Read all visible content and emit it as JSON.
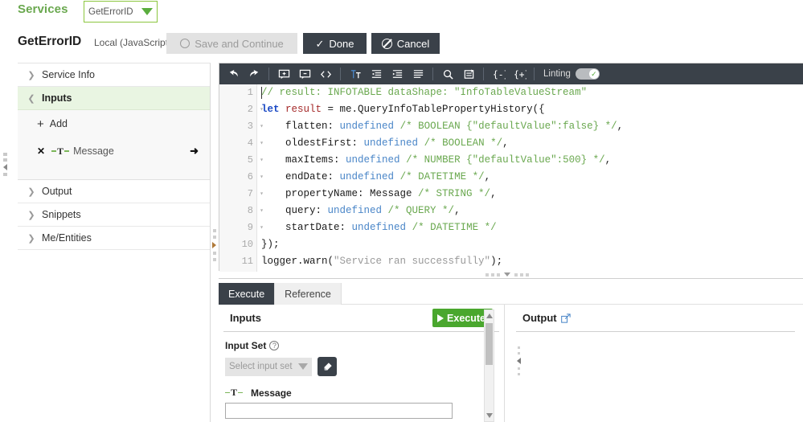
{
  "topbar": {
    "services_label": "Services",
    "entity_name": "GetErrorID",
    "dropdown_icon": "chevron-down-icon"
  },
  "header": {
    "service_name": "GetErrorID",
    "service_subtitle": "Local (JavaScript)",
    "buttons": {
      "save_and_continue": "Save and Continue",
      "done": "Done",
      "cancel": "Cancel"
    }
  },
  "sidebar": {
    "sections": [
      {
        "label": "Service Info",
        "expanded": false
      },
      {
        "label": "Inputs",
        "expanded": true
      },
      {
        "label": "Output",
        "expanded": false
      },
      {
        "label": "Snippets",
        "expanded": false
      },
      {
        "label": "Me/Entities",
        "expanded": false
      }
    ],
    "inputs": {
      "add_label": "Add",
      "items": [
        {
          "name": "Message",
          "type_icon": "string-type-icon",
          "remove_icon": "close-icon",
          "go_icon": "arrow-right-icon"
        }
      ]
    }
  },
  "editor": {
    "toolbar": {
      "icons": [
        "undo-icon",
        "redo-icon",
        "add-comment-icon",
        "remove-comment-icon",
        "code-snippet-icon",
        "font-size-icon",
        "indent-decrease-icon",
        "indent-increase-icon",
        "format-lines-icon",
        "search-icon",
        "find-replace-icon",
        "collapse-braces-icon",
        "expand-braces-icon"
      ],
      "linting_label": "Linting",
      "linting_enabled": true
    },
    "lines": [
      {
        "n": "1",
        "fold": false,
        "tokens": [
          {
            "t": "// result: INFOTABLE dataShape: \"InfoTableValueStream\"",
            "c": "com"
          }
        ]
      },
      {
        "n": "2",
        "fold": true,
        "tokens": [
          {
            "t": "let ",
            "c": "kw"
          },
          {
            "t": "result",
            "c": "var"
          },
          {
            "t": " = me.QueryInfoTablePropertyHistory({",
            "c": "plain"
          }
        ]
      },
      {
        "n": "3",
        "fold": true,
        "tokens": [
          {
            "t": "    flatten: ",
            "c": "plain"
          },
          {
            "t": "undefined",
            "c": "und"
          },
          {
            "t": " ",
            "c": "plain"
          },
          {
            "t": "/* BOOLEAN {\"defaultValue\":false} */",
            "c": "com"
          },
          {
            "t": ",",
            "c": "plain"
          }
        ]
      },
      {
        "n": "4",
        "fold": true,
        "tokens": [
          {
            "t": "    oldestFirst: ",
            "c": "plain"
          },
          {
            "t": "undefined",
            "c": "und"
          },
          {
            "t": " ",
            "c": "plain"
          },
          {
            "t": "/* BOOLEAN */",
            "c": "com"
          },
          {
            "t": ",",
            "c": "plain"
          }
        ]
      },
      {
        "n": "5",
        "fold": true,
        "tokens": [
          {
            "t": "    maxItems: ",
            "c": "plain"
          },
          {
            "t": "undefined",
            "c": "und"
          },
          {
            "t": " ",
            "c": "plain"
          },
          {
            "t": "/* NUMBER {\"defaultValue\":500} */",
            "c": "com"
          },
          {
            "t": ",",
            "c": "plain"
          }
        ]
      },
      {
        "n": "6",
        "fold": true,
        "tokens": [
          {
            "t": "    endDate: ",
            "c": "plain"
          },
          {
            "t": "undefined",
            "c": "und"
          },
          {
            "t": " ",
            "c": "plain"
          },
          {
            "t": "/* DATETIME */",
            "c": "com"
          },
          {
            "t": ",",
            "c": "plain"
          }
        ]
      },
      {
        "n": "7",
        "fold": true,
        "tokens": [
          {
            "t": "    propertyName: Message ",
            "c": "plain"
          },
          {
            "t": "/* STRING */",
            "c": "com"
          },
          {
            "t": ",",
            "c": "plain"
          }
        ]
      },
      {
        "n": "8",
        "fold": true,
        "tokens": [
          {
            "t": "    query: ",
            "c": "plain"
          },
          {
            "t": "undefined",
            "c": "und"
          },
          {
            "t": " ",
            "c": "plain"
          },
          {
            "t": "/* QUERY */",
            "c": "com"
          },
          {
            "t": ",",
            "c": "plain"
          }
        ]
      },
      {
        "n": "9",
        "fold": true,
        "tokens": [
          {
            "t": "    startDate: ",
            "c": "plain"
          },
          {
            "t": "undefined",
            "c": "und"
          },
          {
            "t": " ",
            "c": "plain"
          },
          {
            "t": "/* DATETIME */",
            "c": "com"
          }
        ]
      },
      {
        "n": "10",
        "fold": false,
        "tokens": [
          {
            "t": "});",
            "c": "plain"
          }
        ]
      },
      {
        "n": "11",
        "fold": false,
        "tokens": [
          {
            "t": "logger.warn(",
            "c": "plain"
          },
          {
            "t": "\"Service ran successfully\"",
            "c": "str"
          },
          {
            "t": ");",
            "c": "plain"
          }
        ]
      }
    ]
  },
  "bottom": {
    "tabs": [
      {
        "label": "Execute",
        "selected": true
      },
      {
        "label": "Reference",
        "selected": false
      }
    ],
    "inputs_pane": {
      "title": "Inputs",
      "execute_button": "Execute",
      "input_set_label": "Input Set",
      "input_set_placeholder": "Select input set",
      "clear_icon": "eraser-icon",
      "fields": [
        {
          "label": "Message",
          "value": "",
          "type_icon": "string-type-icon"
        }
      ]
    },
    "output_pane": {
      "title": "Output",
      "popout_icon": "open-in-new-icon"
    }
  },
  "colors": {
    "accent_green": "#6aa84f",
    "dark": "#3a4149",
    "execute_green": "#4aa72e",
    "active_row": "#e9f5e2"
  }
}
